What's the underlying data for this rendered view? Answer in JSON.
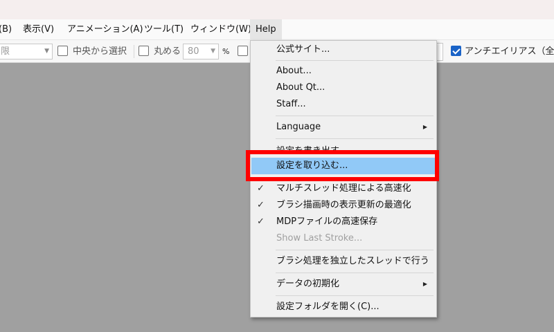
{
  "menubar": {
    "items": [
      "(B)",
      "表示(V)",
      "アニメーション(A)",
      "ツール(T)",
      "ウィンドウ(W)",
      "Help"
    ],
    "open_item": "Help"
  },
  "toolbar": {
    "combo_fragment": "限",
    "center_select_label": "中央から選択",
    "round_label": "丸める",
    "round_value": "80",
    "percent_label": "%",
    "antialias_label": "アンチエイリアス（全体",
    "antialias_checked": true,
    "center_select_checked": false,
    "round_checked": false
  },
  "help_menu": {
    "items": [
      {
        "label": "公式サイト...",
        "checked": false,
        "enabled": true,
        "submenu": false
      },
      {
        "label": "About...",
        "checked": false,
        "enabled": true,
        "submenu": false
      },
      {
        "label": "About Qt...",
        "checked": false,
        "enabled": true,
        "submenu": false
      },
      {
        "label": "Staff...",
        "checked": false,
        "enabled": true,
        "submenu": false
      },
      {
        "label": "Language",
        "checked": false,
        "enabled": true,
        "submenu": true
      },
      {
        "label": "設定を書き出す...",
        "checked": false,
        "enabled": true,
        "submenu": false
      },
      {
        "label": "設定を取り込む...",
        "checked": false,
        "enabled": true,
        "submenu": false,
        "highlighted": true
      },
      {
        "label": "マルチスレッド処理による高速化",
        "checked": true,
        "enabled": true,
        "submenu": false
      },
      {
        "label": "ブラシ描画時の表示更新の最適化",
        "checked": true,
        "enabled": true,
        "submenu": false
      },
      {
        "label": "MDPファイルの高速保存",
        "checked": true,
        "enabled": true,
        "submenu": false
      },
      {
        "label": "Show Last Stroke...",
        "checked": false,
        "enabled": false,
        "submenu": false
      },
      {
        "label": "ブラシ処理を独立したスレッドで行う",
        "checked": false,
        "enabled": true,
        "submenu": false
      },
      {
        "label": "データの初期化",
        "checked": false,
        "enabled": true,
        "submenu": true
      },
      {
        "label": "設定フォルダを開く(C)...",
        "checked": false,
        "enabled": true,
        "submenu": false
      }
    ],
    "check_glyph": "✓",
    "submenu_glyph": "▶"
  },
  "colors": {
    "highlight": "#91c9f7",
    "annotation_box": "#ff0000",
    "checkbox_checked": "#1a63c7",
    "canvas_background": "#a0a0a0"
  }
}
